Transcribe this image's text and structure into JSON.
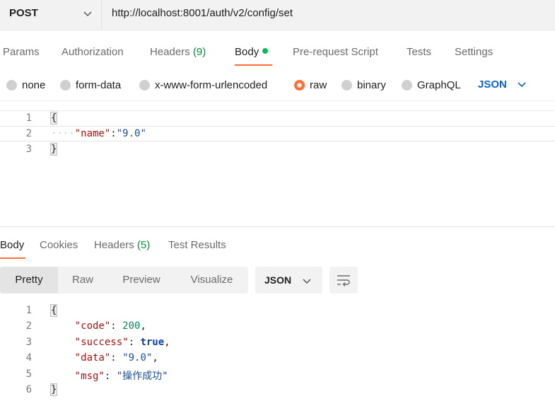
{
  "request": {
    "method": "POST",
    "url": "http://localhost:8001/auth/v2/config/set"
  },
  "request_tabs": [
    {
      "label": "Params"
    },
    {
      "label": "Authorization"
    },
    {
      "label": "Headers",
      "count": "(9)"
    },
    {
      "label": "Body",
      "active": true
    },
    {
      "label": "Pre-request Script"
    },
    {
      "label": "Tests"
    },
    {
      "label": "Settings"
    }
  ],
  "body_types": [
    {
      "label": "none"
    },
    {
      "label": "form-data"
    },
    {
      "label": "x-www-form-urlencoded"
    },
    {
      "label": "raw",
      "selected": true
    },
    {
      "label": "binary"
    },
    {
      "label": "GraphQL"
    }
  ],
  "raw_language": "JSON",
  "request_body": {
    "line_numbers": [
      "1",
      "2",
      "3"
    ],
    "open_brace": "{",
    "indent": "····",
    "key": "\"name\"",
    "colon": ":",
    "value": "\"9.0\"",
    "close_brace": "}"
  },
  "response_tabs": [
    {
      "label": "Body",
      "active": true
    },
    {
      "label": "Cookies"
    },
    {
      "label": "Headers",
      "count": "(5)"
    },
    {
      "label": "Test Results"
    }
  ],
  "response_views": [
    {
      "label": "Pretty",
      "active": true
    },
    {
      "label": "Raw"
    },
    {
      "label": "Preview"
    },
    {
      "label": "Visualize"
    }
  ],
  "response_format": "JSON",
  "response_body": {
    "line_numbers": [
      "1",
      "2",
      "3",
      "4",
      "5",
      "6"
    ],
    "open_brace": "{",
    "code_key": "\"code\"",
    "code_value": "200",
    "success_key": "\"success\"",
    "success_value": "true",
    "data_key": "\"data\"",
    "data_value": "\"9.0\"",
    "msg_key": "\"msg\"",
    "msg_value": "\"操作成功\"",
    "close_brace": "}"
  },
  "colors": {
    "accent": "#ff6c37",
    "link_blue": "#0a63c7",
    "count_green": "#0a8a3e",
    "status_dot": "#0cbb52"
  }
}
